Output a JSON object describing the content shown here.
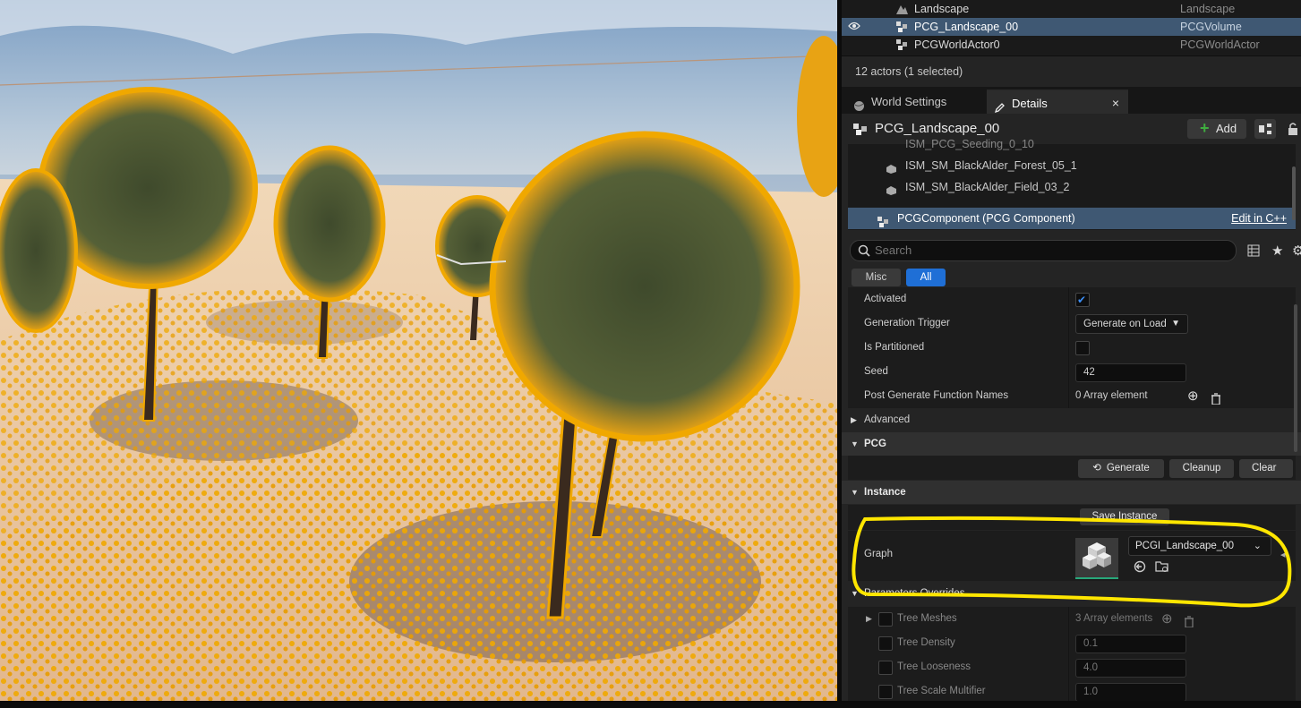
{
  "outliner": {
    "rows": [
      {
        "name": "Landscape",
        "type": "Landscape",
        "selected": false,
        "visible": false,
        "icon": "landscape-icon"
      },
      {
        "name": "PCG_Landscape_00",
        "type": "PCGVolume",
        "selected": true,
        "visible": true,
        "icon": "pcg-icon"
      },
      {
        "name": "PCGWorldActor0",
        "type": "PCGWorldActor",
        "selected": false,
        "visible": false,
        "icon": "pcg-icon"
      }
    ],
    "count": "12 actors (1 selected)"
  },
  "tabs": {
    "world_settings": "World Settings",
    "details": "Details",
    "close": "×"
  },
  "details": {
    "title": "PCG_Landscape_00",
    "add_label": "Add",
    "components": [
      {
        "label": "ISM_SM_BlackAlder_Forest_05_1"
      },
      {
        "label": "ISM_SM_BlackAlder_Field_03_2"
      }
    ],
    "partial_component": "ISM_PCG_Seeding_0_10",
    "selected_component": "PCGComponent (PCG Component)",
    "edit_link": "Edit in C++",
    "search_placeholder": "Search",
    "filters": {
      "misc": "Misc",
      "all": "All"
    }
  },
  "properties": {
    "activated": {
      "label": "Activated",
      "checked": true
    },
    "generation_trigger": {
      "label": "Generation Trigger",
      "value": "Generate on Load"
    },
    "is_partitioned": {
      "label": "Is Partitioned",
      "checked": false
    },
    "seed": {
      "label": "Seed",
      "value": "42"
    },
    "post_generate": {
      "label": "Post Generate Function Names",
      "value": "0 Array element"
    }
  },
  "sections": {
    "advanced": "Advanced",
    "pcg": "PCG",
    "instance": "Instance",
    "parameters": "Parameters Overrides"
  },
  "pcg_buttons": {
    "generate": "Generate",
    "cleanup": "Cleanup",
    "clear": "Clear"
  },
  "instance": {
    "save_label": "Save Instance",
    "graph_label": "Graph",
    "graph_value": "PCGI_Landscape_00"
  },
  "overrides": [
    {
      "label": "Tree Meshes",
      "value": "3 Array elements"
    },
    {
      "label": "Tree Density",
      "value": "0.1"
    },
    {
      "label": "Tree Looseness",
      "value": "4.0"
    },
    {
      "label": "Tree Scale Multifier",
      "value": "1.0"
    }
  ],
  "colors": {
    "selection": "#3f5873",
    "accent_blue": "#1f6fd6",
    "highlight_annotation": "#ffe600",
    "foliage_highlight": "#f0a800"
  }
}
